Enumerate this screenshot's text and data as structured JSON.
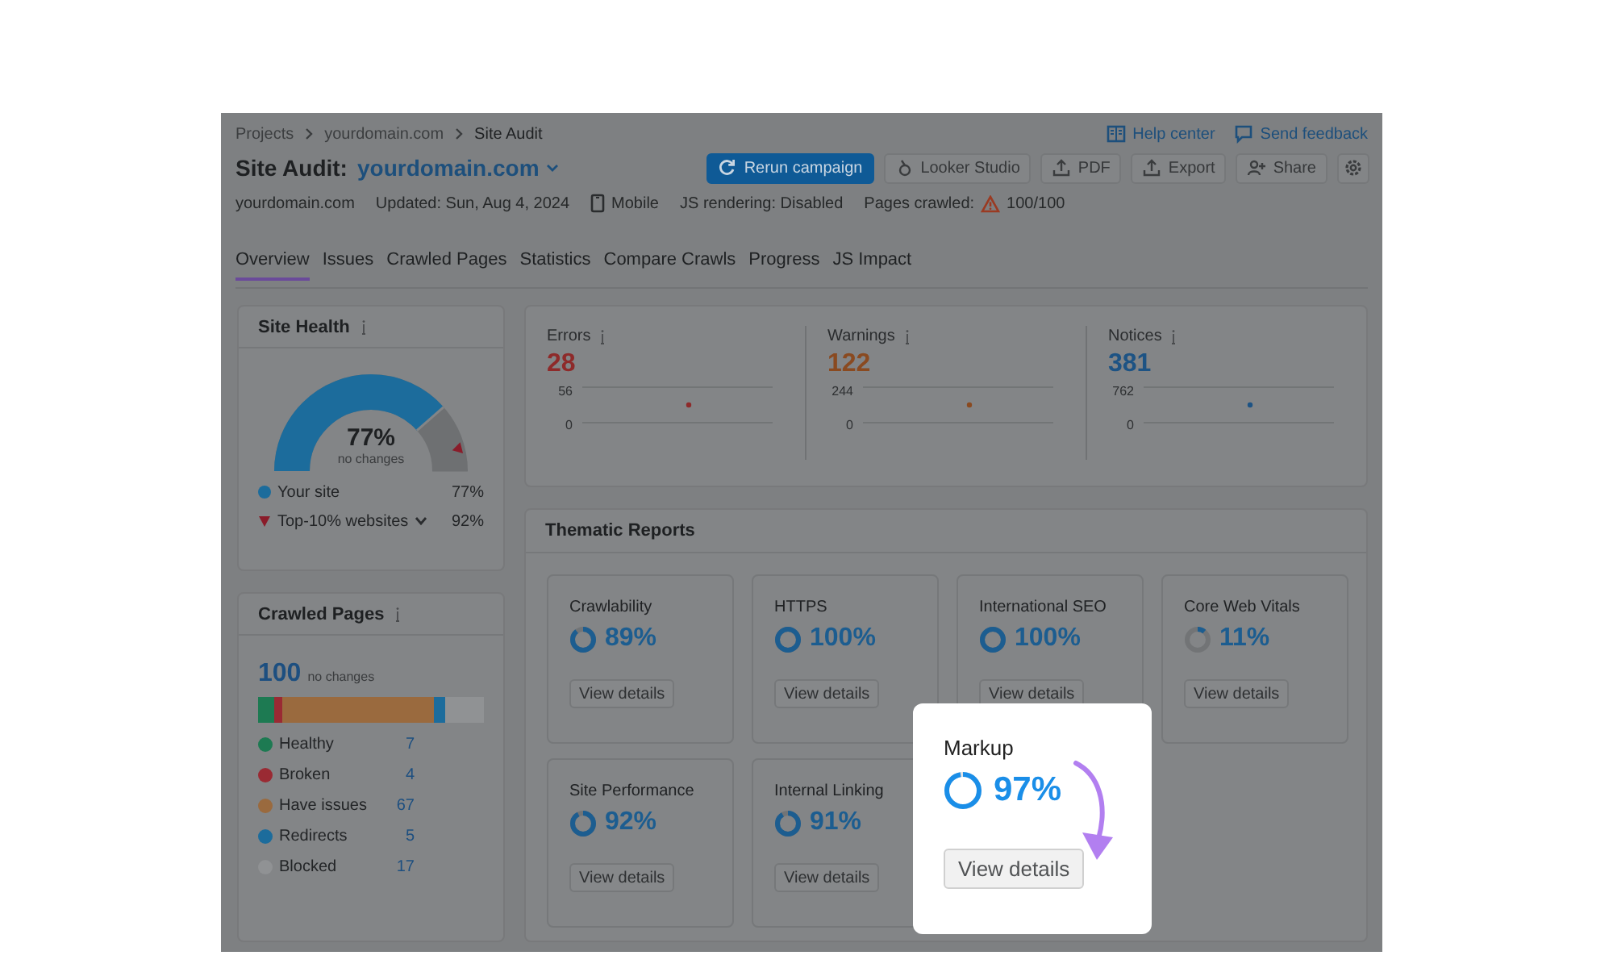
{
  "breadcrumbs": [
    "Projects",
    "yourdomain.com",
    "Site Audit"
  ],
  "header_links": [
    "Help center",
    "Send feedback"
  ],
  "title": {
    "label": "Site Audit:",
    "domain": "yourdomain.com"
  },
  "toolbar": [
    {
      "label": "Rerun campaign",
      "kind": "primary"
    },
    {
      "label": "Looker Studio",
      "kind": "secondary"
    },
    {
      "label": "PDF",
      "kind": "secondary"
    },
    {
      "label": "Export",
      "kind": "secondary"
    },
    {
      "label": "Share",
      "kind": "secondary"
    },
    {
      "kind": "icon"
    }
  ],
  "info": [
    {
      "label": "yourdomain.com",
      "kind": "plain"
    },
    {
      "label": "Updated: Sun, Aug 4, 2024",
      "kind": "plain"
    },
    {
      "label": "Mobile",
      "kind": "device"
    },
    {
      "label": "JS rendering: Disabled",
      "kind": "plain"
    },
    {
      "label": "Pages crawled:",
      "value": "100/100",
      "kind": "warning"
    }
  ],
  "tabs": [
    {
      "label": "Overview",
      "selected": true
    },
    {
      "label": "Issues",
      "selected": false
    },
    {
      "label": "Crawled Pages",
      "selected": false
    },
    {
      "label": "Statistics",
      "selected": false
    },
    {
      "label": "Compare Crawls",
      "selected": false
    },
    {
      "label": "Progress",
      "selected": false
    },
    {
      "label": "JS Impact",
      "selected": false
    }
  ],
  "site_health": {
    "title": "Site Health",
    "value": "77%",
    "note": "no changes",
    "level": 0.77,
    "benchmark": {
      "level": 0.92
    },
    "legend": [
      {
        "label": "Your site",
        "value": "77%",
        "kind": "dot",
        "color": "#1c6c9c",
        "dropdown": false
      },
      {
        "label": "Top-10% websites",
        "value": "92%",
        "kind": "marker",
        "color": "#8a1c2a",
        "dropdown": true
      }
    ]
  },
  "crawled_pages": {
    "title": "Crawled Pages",
    "total": "100",
    "note": "no changes",
    "legend": [
      {
        "label": "Healthy",
        "value": "7",
        "color": "#1d7a52"
      },
      {
        "label": "Broken",
        "value": "4",
        "color": "#9a2a33"
      },
      {
        "label": "Have issues",
        "value": "67",
        "color": "#9a6a3e"
      },
      {
        "label": "Redirects",
        "value": "5",
        "color": "#1c6c9c"
      },
      {
        "label": "Blocked",
        "value": "17",
        "color": "#909294"
      }
    ]
  },
  "metrics": [
    {
      "label": "Errors",
      "value": "28",
      "color": "#8e2a2a",
      "axis_max": "56",
      "axis_min": "0"
    },
    {
      "label": "Warnings",
      "value": "122",
      "color": "#8a4a20",
      "axis_max": "244",
      "axis_min": "0"
    },
    {
      "label": "Notices",
      "value": "381",
      "color": "#1d5384",
      "axis_max": "762",
      "axis_min": "0"
    }
  ],
  "thematic_reports": {
    "title": "Thematic Reports",
    "cards": [
      {
        "title": "Crawlability",
        "value": "89%",
        "level": 0.89,
        "button": "View details",
        "highlighted": false
      },
      {
        "title": "HTTPS",
        "value": "100%",
        "level": 1,
        "button": "View details",
        "highlighted": false
      },
      {
        "title": "International SEO",
        "value": "100%",
        "level": 1,
        "button": "View details",
        "highlighted": false
      },
      {
        "title": "Core Web Vitals",
        "value": "11%",
        "level": 0.11,
        "button": "View details",
        "highlighted": false
      },
      {
        "title": "Site Performance",
        "value": "92%",
        "level": 0.92,
        "button": "View details",
        "highlighted": false
      },
      {
        "title": "Internal Linking",
        "value": "91%",
        "level": 0.91,
        "button": "View details",
        "highlighted": false
      },
      {
        "title": "Markup",
        "value": "97%",
        "level": 0.97,
        "button": "View details",
        "highlighted": true
      }
    ]
  }
}
